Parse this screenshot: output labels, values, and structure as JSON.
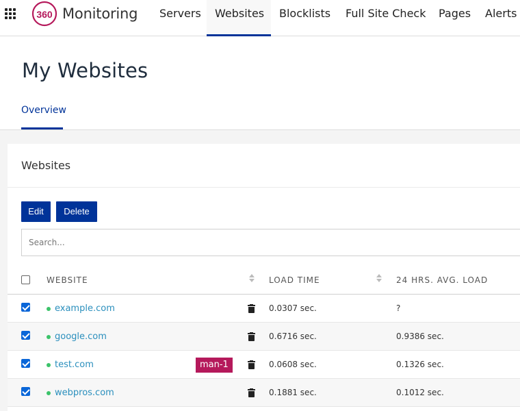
{
  "app": {
    "logo_number": "360",
    "logo_text": "Monitoring"
  },
  "nav": {
    "items": [
      {
        "label": "Servers",
        "active": false
      },
      {
        "label": "Websites",
        "active": true
      },
      {
        "label": "Blocklists",
        "active": false
      },
      {
        "label": "Full Site Check",
        "active": false
      },
      {
        "label": "Pages",
        "active": false
      },
      {
        "label": "Alerts",
        "active": false
      }
    ]
  },
  "page": {
    "title": "My Websites",
    "tabs": [
      {
        "label": "Overview",
        "active": true
      }
    ]
  },
  "card": {
    "title": "Websites",
    "edit_label": "Edit",
    "delete_label": "Delete",
    "search_placeholder": "Search..."
  },
  "table": {
    "header_checked": false,
    "columns": [
      "WEBSITE",
      "LOAD TIME",
      "24 HRS. AVG. LOAD"
    ],
    "rows": [
      {
        "checked": true,
        "status": "up",
        "website": "example.com",
        "tag": "",
        "load_time": "0.0307 sec.",
        "avg_load": "?"
      },
      {
        "checked": true,
        "status": "up",
        "website": "google.com",
        "tag": "",
        "load_time": "0.6716 sec.",
        "avg_load": "0.9386 sec."
      },
      {
        "checked": true,
        "status": "up",
        "website": "test.com",
        "tag": "man-1",
        "load_time": "0.0608 sec.",
        "avg_load": "0.1326 sec."
      },
      {
        "checked": true,
        "status": "up",
        "website": "webpros.com",
        "tag": "",
        "load_time": "0.1881 sec.",
        "avg_load": "0.1012 sec."
      }
    ]
  },
  "colors": {
    "brand": "#003399",
    "status_up": "#3cc36a",
    "tag_bg": "#b5195b",
    "link": "#2a8fbd",
    "logo_accent": "#b5195b"
  },
  "icons": {
    "apps": "apps-grid-icon",
    "sort": "sort-icon",
    "delete_row": "trash-icon"
  }
}
